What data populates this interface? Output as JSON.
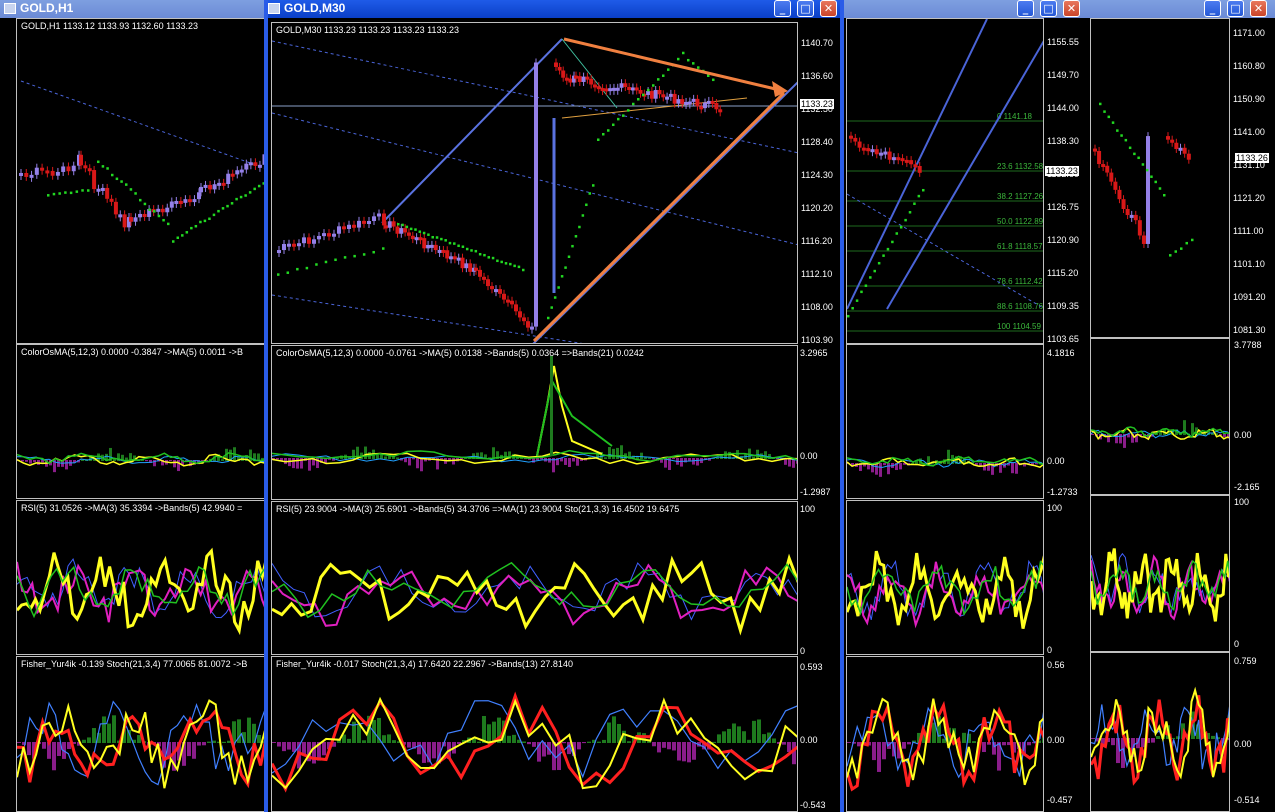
{
  "windows": {
    "h1": {
      "title": "GOLD,H1",
      "chart_header": "GOLD,H1  1133.12 1133.93 1132.60 1133.23",
      "colorosma_header": "ColorOsMA(5,12,3) 0.0000 -0.3847  ->MA(5) 0.0011  ->B",
      "rsi_header": "RSI(5) 31.0526  ->MA(3) 35.3394  ->Bands(5) 42.9940  =",
      "fisher_header": "Fisher_Yur4ik -0.139  Stoch(21,3,4) 77.0065 81.0072  ->B"
    },
    "m30": {
      "title": "GOLD,M30",
      "chart_header": "GOLD,M30  1133.23 1133.23 1133.23 1133.23",
      "price_ticks": [
        "1140.70",
        "1136.60",
        "1132.50",
        "1128.40",
        "1124.30",
        "1120.20",
        "1116.20",
        "1112.10",
        "1108.00",
        "1103.90"
      ],
      "last_price": "1133.23",
      "colorosma_header": "ColorOsMA(5,12,3) 0.0000 -0.0761  ->MA(5) 0.0138  ->Bands(5) 0.0364  =>Bands(21) 0.0242",
      "colorosma_ticks": [
        "3.2965",
        "0.00",
        "-1.2987"
      ],
      "rsi_header": "RSI(5) 23.9004  ->MA(3) 25.6901  ->Bands(5) 34.3706  =>MA(1) 23.9004  Sto(21,3,3) 16.4502 19.6475",
      "rsi_ticks": [
        "100",
        "0"
      ],
      "fisher_header": "Fisher_Yur4ik -0.017  Stoch(21,3,4) 17.6420 22.2967  ->Bands(13) 27.8140",
      "fisher_ticks": [
        "0.593",
        "0.00",
        "-0.543"
      ],
      "buttons": {
        "minimize": "_",
        "maximize": "□",
        "close": "✕"
      }
    },
    "w3": {
      "price_ticks": [
        "1155.55",
        "1149.70",
        "1144.00",
        "1138.30",
        "1132.60",
        "1126.75",
        "1120.90",
        "1115.20",
        "1109.35",
        "1103.65"
      ],
      "last_price": "1133.23",
      "fib_labels": [
        "0 1141.18",
        "23.6 1132.58",
        "38.2 1127.26",
        "50.0 1122.89",
        "61.8 1118.57",
        "78.6 1112.42",
        "88.6 1108.76",
        "100 1104.59"
      ],
      "colorosma_ticks": [
        "4.1816",
        "0.00",
        "-1.2733"
      ],
      "rsi_ticks": [
        "100",
        "0"
      ],
      "fisher_ticks": [
        "0.56",
        "0.00",
        "-0.457"
      ]
    },
    "w4": {
      "price_ticks": [
        "1171.00",
        "1160.80",
        "1150.90",
        "1141.00",
        "1131.10",
        "1121.20",
        "1111.00",
        "1101.10",
        "1091.20",
        "1081.30"
      ],
      "last_price": "1133.26",
      "colorosma_ticks": [
        "3.7788",
        "0.00",
        "-2.165"
      ],
      "rsi_ticks": [
        "100",
        "0"
      ],
      "fisher_ticks": [
        "0.759",
        "0.00",
        "-0.514"
      ]
    }
  },
  "colors": {
    "bull": "#9480e8",
    "bear": "#d81818",
    "sar": "#22d822",
    "channel": "#4a64d8",
    "arrow": "#f08040",
    "yellow": "#ffff20",
    "magenta": "#e020c0",
    "hist_green": "#1e7a1e",
    "hist_purple": "#8a1d8a"
  }
}
